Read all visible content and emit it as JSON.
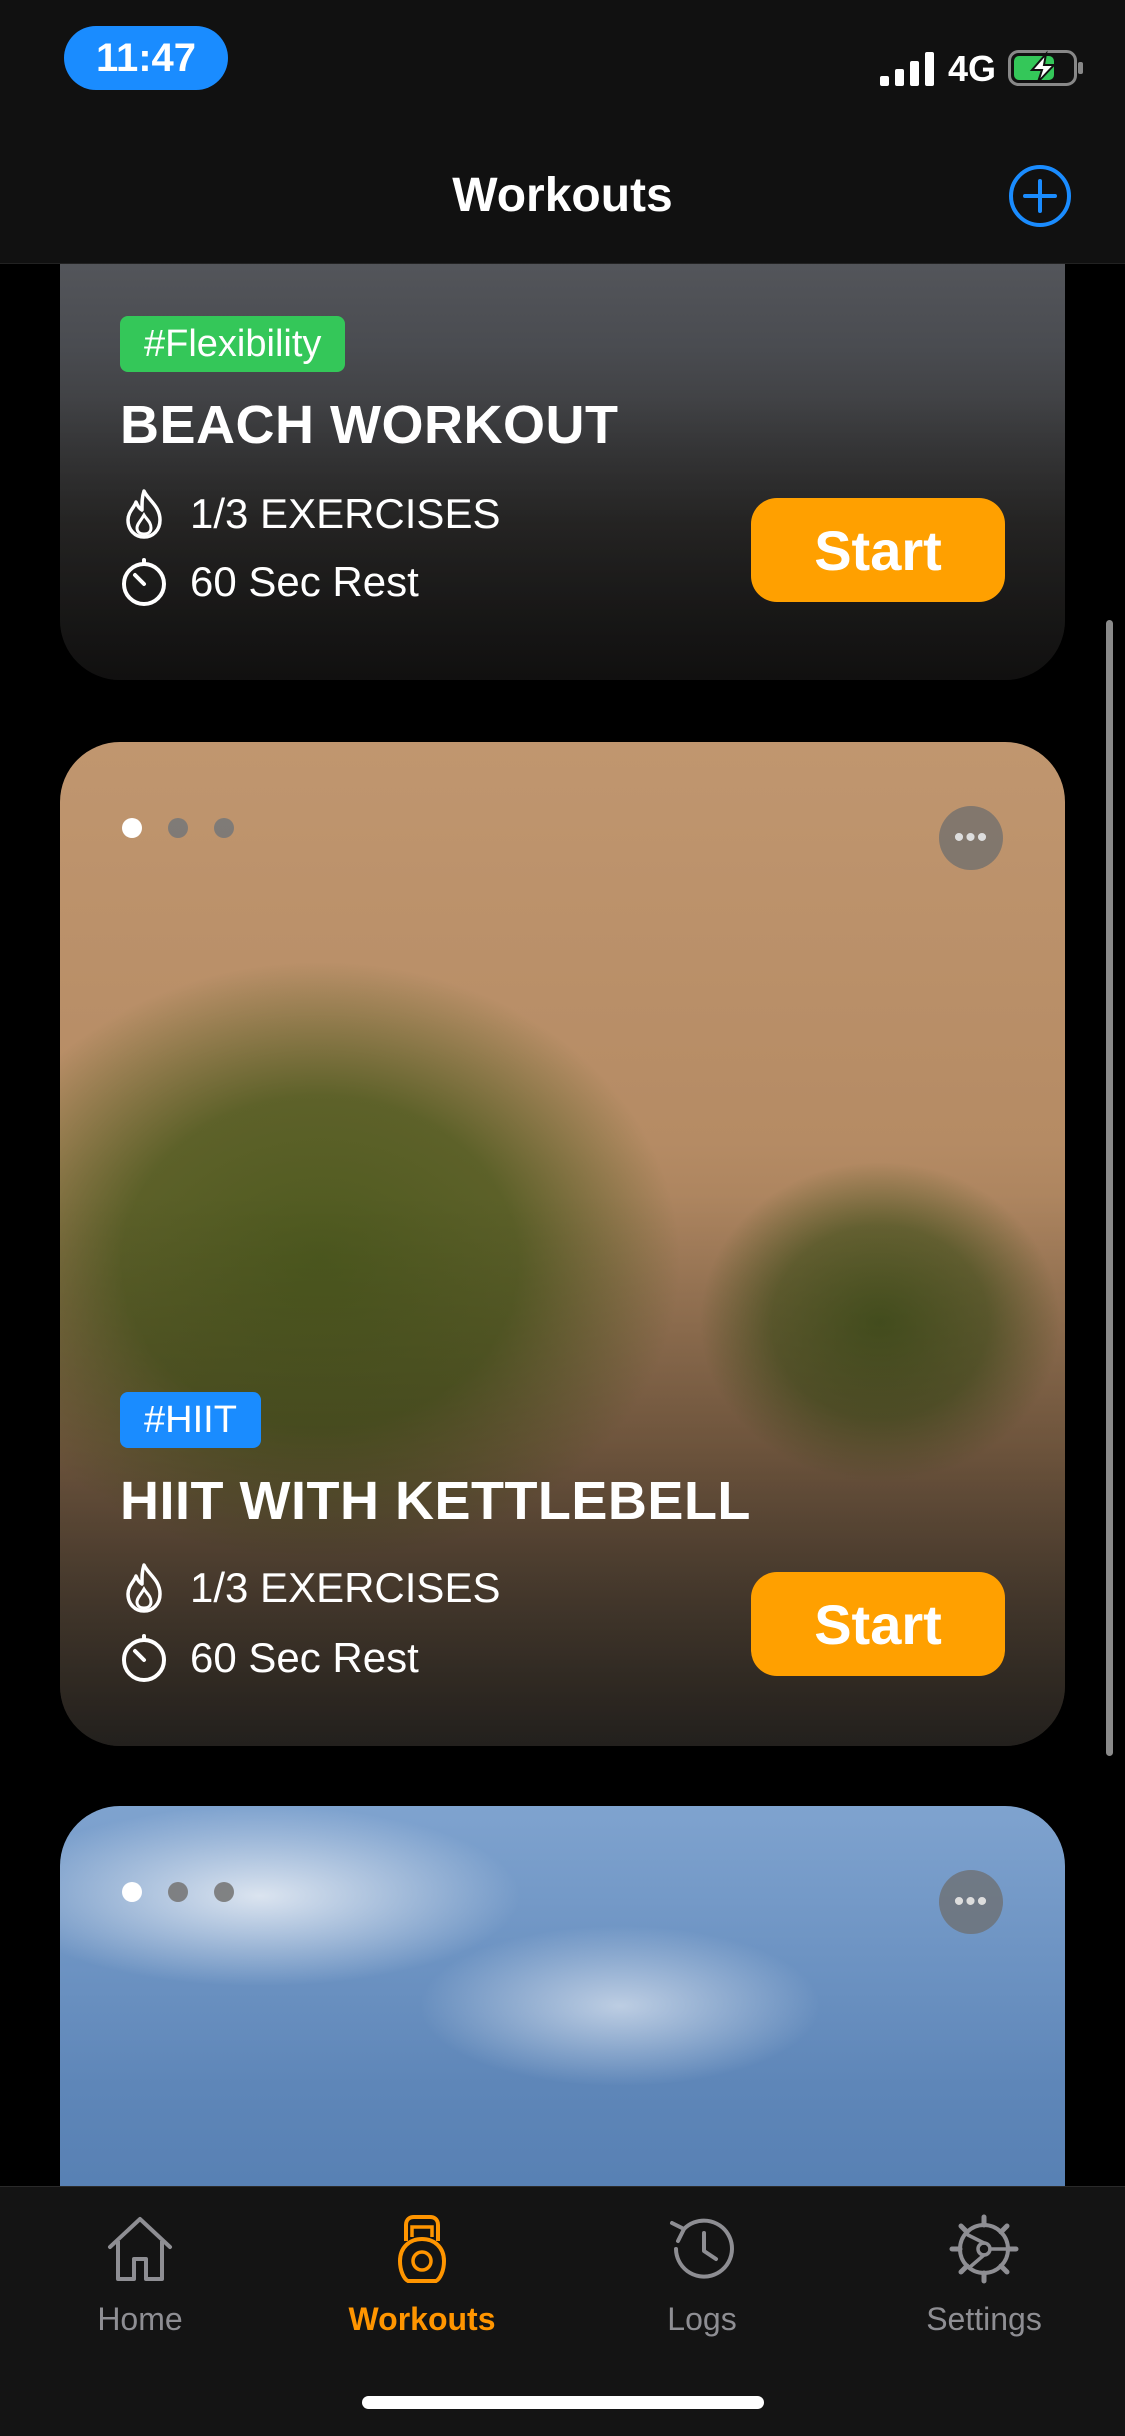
{
  "status_bar": {
    "time": "11:47",
    "network": "4G"
  },
  "nav": {
    "title": "Workouts"
  },
  "workouts": [
    {
      "tag": "#Flexibility",
      "title": "BEACH WORKOUT",
      "exercises": "1/3 EXERCISES",
      "rest": "60 Sec Rest",
      "start_label": "Start"
    },
    {
      "tag": "#HIIT",
      "title": "HIIT WITH KETTLEBELL",
      "exercises": "1/3 EXERCISES",
      "rest": "60 Sec Rest",
      "start_label": "Start"
    },
    {
      "tag": "",
      "title": "",
      "exercises": "",
      "rest": "",
      "start_label": ""
    }
  ],
  "tabs": [
    {
      "label": "Home",
      "icon": "home-icon",
      "active": false
    },
    {
      "label": "Workouts",
      "icon": "kettlebell-icon",
      "active": true
    },
    {
      "label": "Logs",
      "icon": "history-icon",
      "active": false
    },
    {
      "label": "Settings",
      "icon": "gear-icon",
      "active": false
    }
  ],
  "colors": {
    "accent_orange": "#ff9500",
    "start_button": "#ffa000",
    "tag_green": "#34c759",
    "tag_blue": "#1a8cff",
    "time_pill": "#1a8cff"
  }
}
